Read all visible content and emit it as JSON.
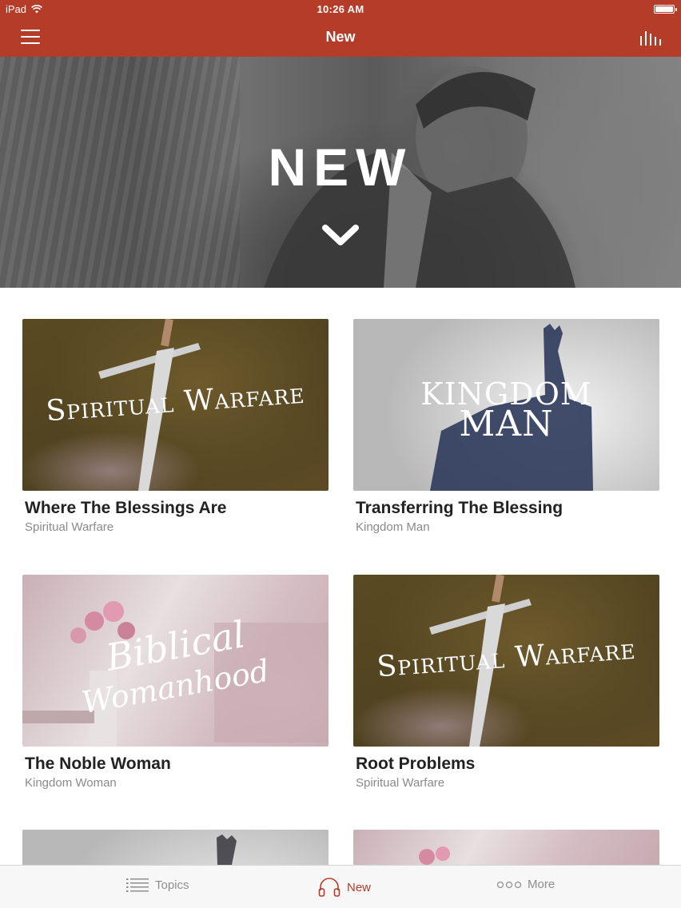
{
  "status": {
    "device": "iPad",
    "time": "10:26 AM"
  },
  "nav": {
    "title": "New"
  },
  "hero": {
    "heading": "NEW"
  },
  "items": [
    {
      "title": "Where The Blessings Are",
      "series": "Spiritual Warfare",
      "art_text": "Spiritual Warfare"
    },
    {
      "title": "Transferring The Blessing",
      "series": "Kingdom Man",
      "art_line1": "Kingdom",
      "art_line2": "Man"
    },
    {
      "title": "The Noble Woman",
      "series": "Kingdom Woman",
      "art_line1": "Biblical",
      "art_line2": "Womanhood"
    },
    {
      "title": "Root Problems",
      "series": "Spiritual Warfare",
      "art_text": "Spiritual Warfare"
    }
  ],
  "tabs": [
    {
      "label": "Topics",
      "icon": "list-icon"
    },
    {
      "label": "New",
      "icon": "headphones-icon",
      "active": true
    },
    {
      "label": "More",
      "icon": "more-dots-icon"
    }
  ],
  "colors": {
    "brand": "#b43c28",
    "tab_inactive": "#8e8e8e"
  }
}
